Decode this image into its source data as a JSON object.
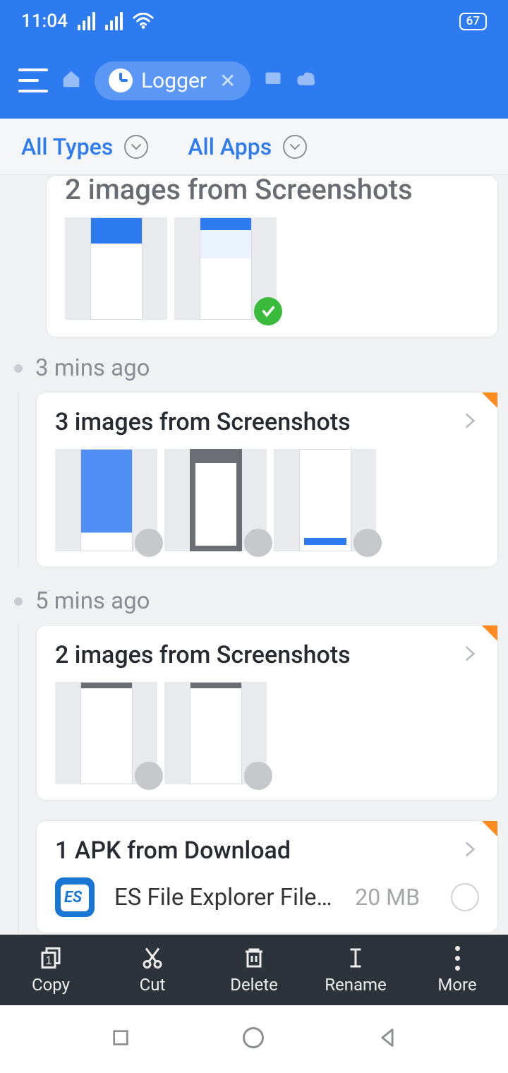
{
  "status": {
    "time": "11:04",
    "battery": "67"
  },
  "appbar": {
    "tab_label": "Logger"
  },
  "filters": {
    "types": "All Types",
    "apps": "All Apps"
  },
  "groups": [
    {
      "partial": true,
      "title": "2 images from Screenshots",
      "thumbs": [
        {
          "selected": false
        },
        {
          "selected": true
        }
      ]
    },
    {
      "time_label": "3 mins ago",
      "title": "3 images from Screenshots",
      "thumbs": [
        {
          "selected": false
        },
        {
          "selected": false
        },
        {
          "selected": false
        }
      ]
    },
    {
      "time_label": "5 mins ago",
      "title": "2 images from Screenshots",
      "thumbs": [
        {
          "selected": false
        },
        {
          "selected": false
        }
      ],
      "file": {
        "header": "1 APK from Download",
        "name": "ES File Explorer File Ma…",
        "size": "20 MB"
      }
    }
  ],
  "actions": {
    "copy": "Copy",
    "cut": "Cut",
    "delete": "Delete",
    "rename": "Rename",
    "more": "More"
  }
}
